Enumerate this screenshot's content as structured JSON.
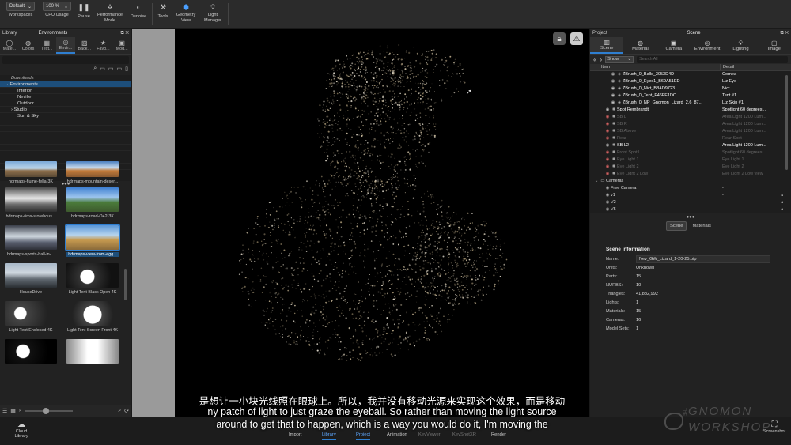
{
  "toolbar": {
    "workspace_value": "Default",
    "workspace_label": "Workspaces",
    "cpu_value": "100 %",
    "cpu_label": "CPU Usage",
    "pause_label": "Pause",
    "performance_label_1": "Performance",
    "performance_label_2": "Mode",
    "denoise_label": "Denoise",
    "tools_label": "Tools",
    "geometry_label_1": "Geometry",
    "geometry_label_2": "View",
    "light_label_1": "Light",
    "light_label_2": "Manager"
  },
  "library": {
    "panel_title": "Library",
    "panel_subtitle": "Environments",
    "tabs": [
      "Mate...",
      "Colors",
      "Text...",
      "Envir...",
      "Back...",
      "Favo...",
      "Mod..."
    ],
    "active_tab": 3,
    "tree": [
      {
        "label": "Downloads",
        "indent": 1,
        "italic": true
      },
      {
        "label": "Environments",
        "indent": 0,
        "expander": "⌄",
        "selected": true
      },
      {
        "label": "Interior",
        "indent": 2
      },
      {
        "label": "Neville",
        "indent": 2
      },
      {
        "label": "Outdoor",
        "indent": 2
      },
      {
        "label": "Studio",
        "indent": 1,
        "expander": "›"
      },
      {
        "label": "Sun & Sky",
        "indent": 2
      }
    ],
    "thumbnails": [
      {
        "label": "hdrmaps-flume-fella-3K"
      },
      {
        "label": "hdrmaps-mountain-deser..."
      },
      {
        "label": "hdrmaps-rims-storehous..."
      },
      {
        "label": "hdrmaps-road-O42-3K"
      },
      {
        "label": "hdrmaps-sports-hall-in-..."
      },
      {
        "label": "hdrmaps-view-from-egg...",
        "selected": true
      },
      {
        "label": "HouseDrive"
      },
      {
        "label": "Light Tent Black Open 4K"
      },
      {
        "label": "Light Tent Enclosed 4K"
      },
      {
        "label": "Light Tent Screen Front 4K"
      },
      {
        "label": ""
      },
      {
        "label": ""
      }
    ]
  },
  "project": {
    "panel_title": "Project",
    "panel_subtitle": "Scene",
    "tabs": [
      "Scene",
      "Material",
      "Camera",
      "Environment",
      "Lighting",
      "Image"
    ],
    "active_tab": 0,
    "show_value": "Show",
    "search_placeholder": "Search All",
    "col_item": "Item",
    "col_detail": "Detail",
    "rows": [
      {
        "item": "ZBrush_0_Balls_3053D4D",
        "detail": "Cornea",
        "indent": 3,
        "eye": true,
        "icon": "◈",
        "style": "bold"
      },
      {
        "item": "ZBrush_0_Eyes1_B69A51ED",
        "detail": "Liz Eye",
        "indent": 3,
        "eye": true,
        "icon": "◈",
        "style": "bold"
      },
      {
        "item": "ZBrush_0_Nict_B8AD9723",
        "detail": "Nict",
        "indent": 3,
        "eye": true,
        "icon": "◈",
        "style": "bold"
      },
      {
        "item": "ZBrush_0_Tent_F46FE1DC",
        "detail": "Tent #1",
        "indent": 3,
        "eye": true,
        "icon": "◈",
        "style": "bold"
      },
      {
        "item": "ZBrush_0_NP_Gnomon_Lizard_2.6_87...",
        "detail": "Liz Skin #1",
        "indent": 3,
        "eye": true,
        "icon": "◈",
        "style": "bold"
      },
      {
        "item": "Spot Rembrandt",
        "detail": "Spotlight 60 degrees...",
        "indent": 2,
        "eye": true,
        "icon": "✺",
        "style": "bold"
      },
      {
        "item": "SB L",
        "detail": "Area Light 1200 Lum...",
        "indent": 2,
        "eye": "red",
        "icon": "✺",
        "style": "dim"
      },
      {
        "item": "SB R",
        "detail": "Area Light 1200 Lum...",
        "indent": 2,
        "eye": "red",
        "icon": "✺",
        "style": "dim"
      },
      {
        "item": "SB Above",
        "detail": "Area Light 1200 Lum...",
        "indent": 2,
        "eye": "red",
        "icon": "✺",
        "style": "dim"
      },
      {
        "item": "Rear",
        "detail": "Rear Spot",
        "indent": 2,
        "eye": "red",
        "icon": "✺",
        "style": "dim"
      },
      {
        "item": "SB L2",
        "detail": "Area Light 1200 Lum...",
        "indent": 2,
        "eye": true,
        "icon": "✺",
        "style": "bold"
      },
      {
        "item": "Front Spot1",
        "detail": "Spotlight 60 degrees...",
        "indent": 2,
        "eye": "red",
        "icon": "✺",
        "style": "dim"
      },
      {
        "item": "Eye Light 1",
        "detail": "Eye Light 1",
        "indent": 2,
        "eye": "red",
        "icon": "✺",
        "style": "dim"
      },
      {
        "item": "Eye Light 2",
        "detail": "Eye Light 2",
        "indent": 2,
        "eye": "red",
        "icon": "✺",
        "style": "dim"
      },
      {
        "item": "Eye Light 2 Low",
        "detail": "Eye Light 2 Low view",
        "indent": 2,
        "eye": "red",
        "icon": "✺",
        "style": "dim"
      },
      {
        "item": "Cameras",
        "detail": "",
        "indent": 0,
        "expander": "⌄",
        "icon": "▭",
        "style": "normal"
      },
      {
        "item": "Free Camera",
        "detail": "-",
        "indent": 2,
        "icon": "◉",
        "style": "normal"
      },
      {
        "item": "v1",
        "detail": "-",
        "indent": 2,
        "icon": "◉",
        "style": "normal",
        "lock": true
      },
      {
        "item": "V2",
        "detail": "-",
        "indent": 2,
        "icon": "◉",
        "style": "normal",
        "lock": true
      },
      {
        "item": "V5",
        "detail": "-",
        "indent": 2,
        "icon": "◉",
        "style": "normal",
        "lock": true
      }
    ],
    "info_tabs": [
      "Scene",
      "Materials"
    ],
    "info_active": 0,
    "info_title": "Scene Information",
    "info": [
      {
        "k": "Name:",
        "v": "Nev_GW_Lizard_1-20-25.bip",
        "field": true
      },
      {
        "k": "Units:",
        "v": "Unknown"
      },
      {
        "k": "Parts:",
        "v": "15"
      },
      {
        "k": "NURBS:",
        "v": "10"
      },
      {
        "k": "Triangles:",
        "v": "41,882,992"
      },
      {
        "k": "Lights:",
        "v": "1"
      },
      {
        "k": "Materials:",
        "v": "15"
      },
      {
        "k": "Cameras:",
        "v": "16"
      },
      {
        "k": "Model Sets:",
        "v": "1"
      }
    ]
  },
  "bottom": {
    "cloud_label_1": "Cloud",
    "cloud_label_2": "Library",
    "tabs": [
      {
        "label": "Import",
        "state": "normal"
      },
      {
        "label": "Library",
        "state": "active"
      },
      {
        "label": "Project",
        "state": "active"
      },
      {
        "label": "Animation",
        "state": "normal"
      },
      {
        "label": "KeyViewer",
        "state": "dim"
      },
      {
        "label": "KeyShotXR",
        "state": "dim"
      },
      {
        "label": "Render",
        "state": "normal"
      }
    ],
    "screenshot_label": "Screenshot"
  },
  "subtitles": {
    "cn": "是想让一小块光线照在眼球上。所以，我并没有移动光源来实现这个效果，而是移动",
    "en1": "ny patch of light to just graze the eyeball. So rather than moving the light source",
    "en2": "around to get that to happen, which is a way you would do it, I'm moving the"
  },
  "watermark": {
    "line1": "GNOMON",
    "line2": "WORKSHOP",
    "the": "THE"
  }
}
